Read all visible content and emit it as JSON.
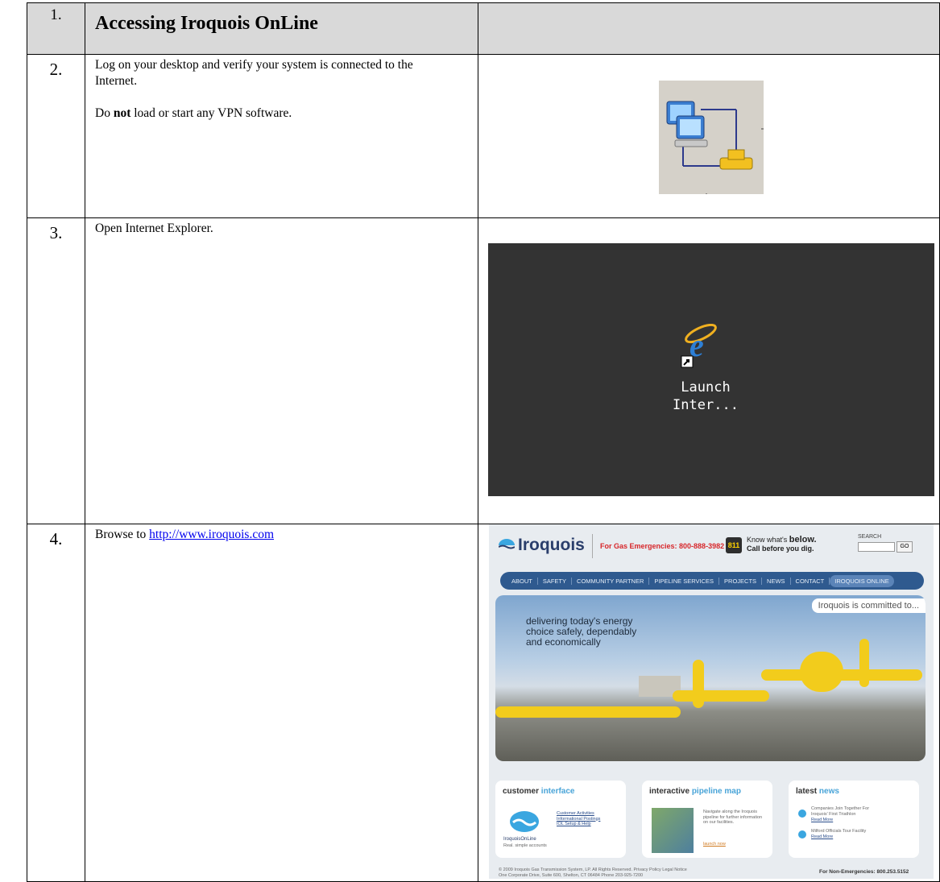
{
  "table": {
    "rows": [
      {
        "num": "1.",
        "title": "Accessing Iroquois OnLine"
      },
      {
        "num": "2.",
        "line1": "Log on your desktop and verify your system is connected to the Internet.",
        "line2_pre": "Do ",
        "line2_bold": "not",
        "line2_post": " load or start any VPN software."
      },
      {
        "num": "3.",
        "text": "Open Internet Explorer."
      },
      {
        "num": "4.",
        "text_pre": "Browse to ",
        "link": "http://www.iroquois.com"
      }
    ]
  },
  "desktop": {
    "icon": "internet-explorer-icon",
    "label_line1": "Launch",
    "label_line2": "Inter..."
  },
  "website": {
    "logo": "Iroquois",
    "emergency": "For Gas Emergencies: 800-888-3982",
    "badge": "811",
    "know_line1_pre": "Know what's ",
    "know_line1_bold": "below.",
    "know_line2": "Call before you dig.",
    "search_label": "SEARCH",
    "go_label": "GO",
    "nav": [
      "ABOUT",
      "SAFETY",
      "COMMUNITY PARTNER",
      "PIPELINE SERVICES",
      "PROJECTS",
      "NEWS",
      "CONTACT",
      "IROQUOIS ONLINE"
    ],
    "hero_tag": "Iroquois is committed to...",
    "hero_line1": "delivering today's energy",
    "hero_line2": "choice safely, dependably",
    "hero_line3": "and economically",
    "panel1": {
      "h1": "customer",
      "h2": "interface",
      "links": [
        "Customer Activities",
        "Informational Postings",
        "IOL Setup & Help"
      ],
      "brand": "IroquoisOnLine",
      "brand_sub": "Real. simple accounts"
    },
    "panel2": {
      "h1": "interactive",
      "h2": "pipeline map",
      "desc": "Navigate along the Iroquois pipeline for further information on our facilities.",
      "link": "launch now"
    },
    "panel3": {
      "h1": "latest",
      "h2": "news",
      "item1": "Companies Join Together For Iroquois' First Triathlon",
      "item1_link": "Read More",
      "item2": "Milford Officials Tour Facility",
      "item2_link": "Read More"
    },
    "footer_line1": "© 2009 Iroquois Gas Transmission System, LP. All Rights Reserved. Privacy Policy Legal Notice",
    "footer_line2": "One Corporate Drive, Suite 600, Shelton, CT 06484 Phone 203-925-7200",
    "footer_right": "For Non-Emergencies: 800.253.5152"
  }
}
